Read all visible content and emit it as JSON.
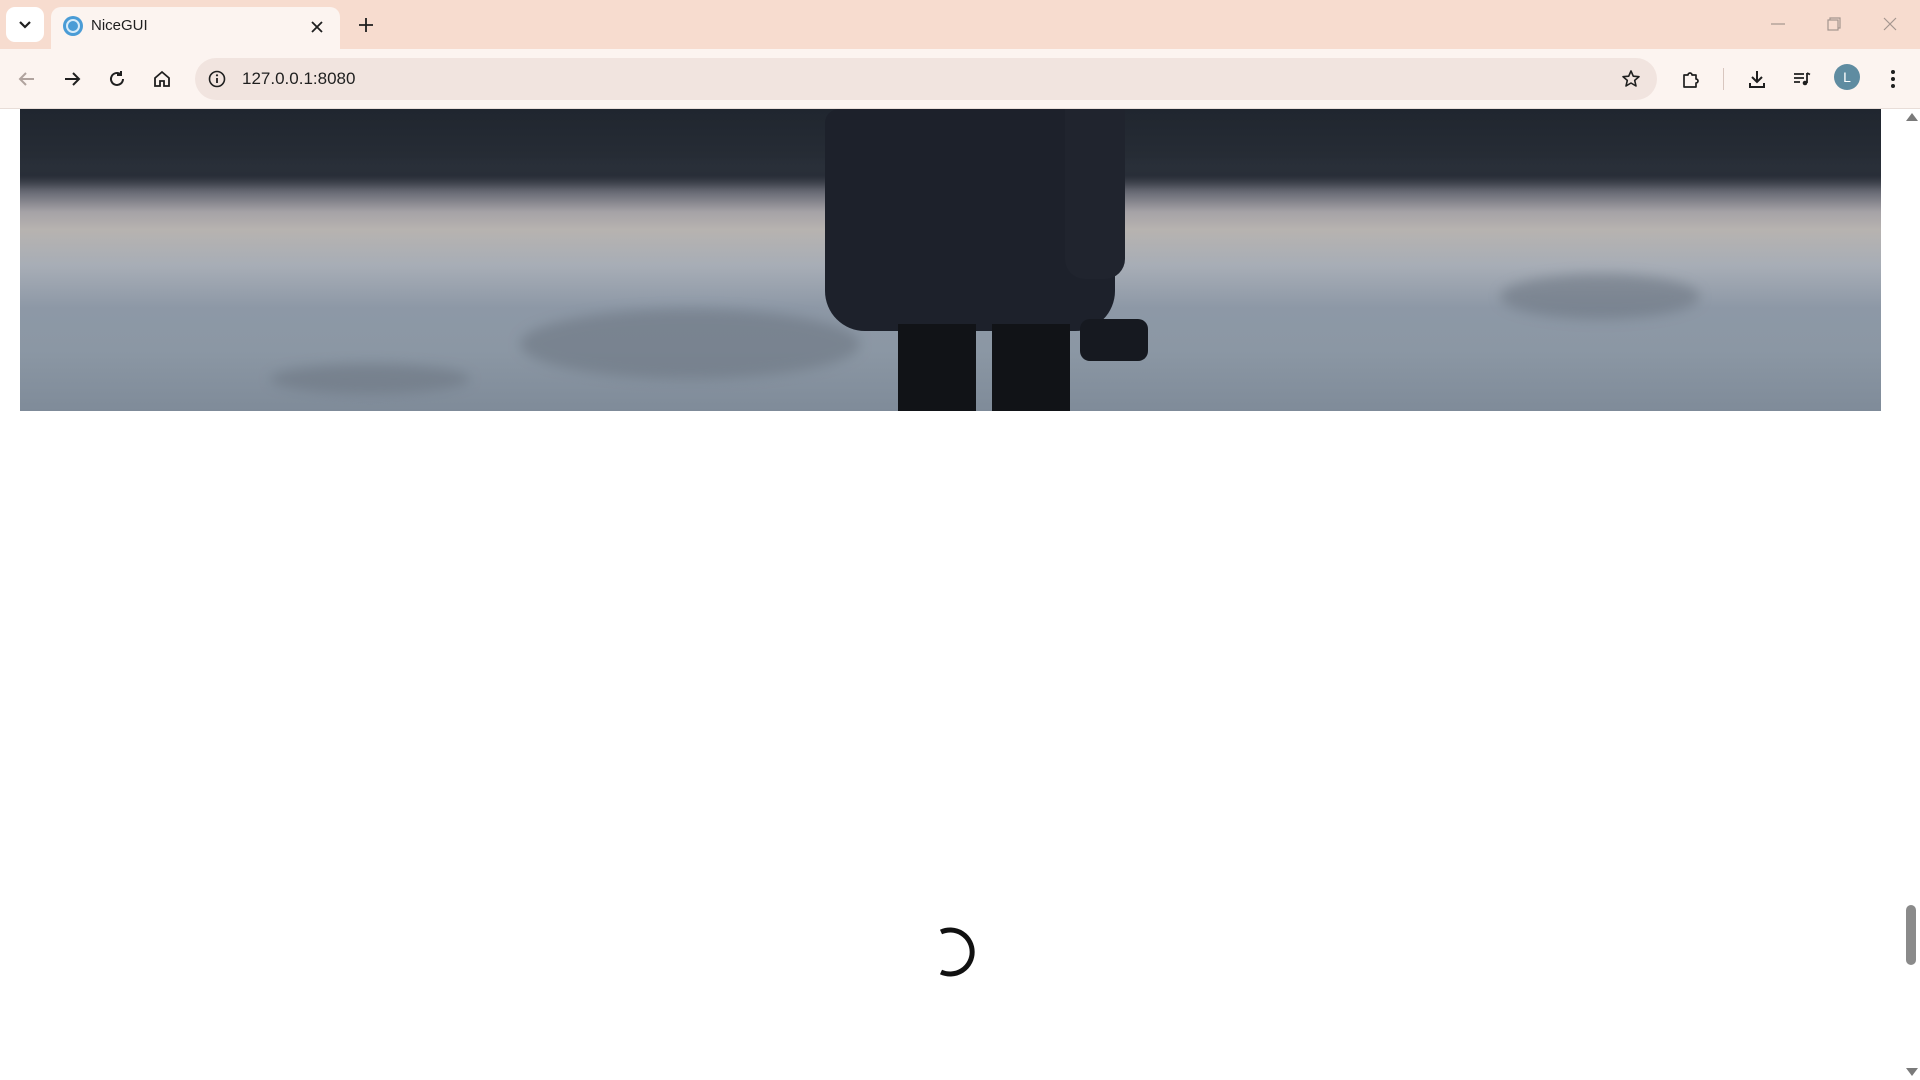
{
  "browser": {
    "tab": {
      "title": "NiceGUI",
      "favicon": "nicegui-favicon-icon"
    },
    "address_bar": {
      "url": "127.0.0.1:8080"
    },
    "profile_initial": "L",
    "colors": {
      "tab_strip": "#f7dccf",
      "toolbar": "#fcf4f0",
      "omnibox": "#f1e4df",
      "avatar": "#5f8ca1"
    }
  },
  "content": {
    "hero_image": {
      "description_icon": "lake-photo-image"
    },
    "loading": {
      "icon": "spinner-icon"
    }
  },
  "scrollbar": {
    "position_fraction": 0.82
  }
}
